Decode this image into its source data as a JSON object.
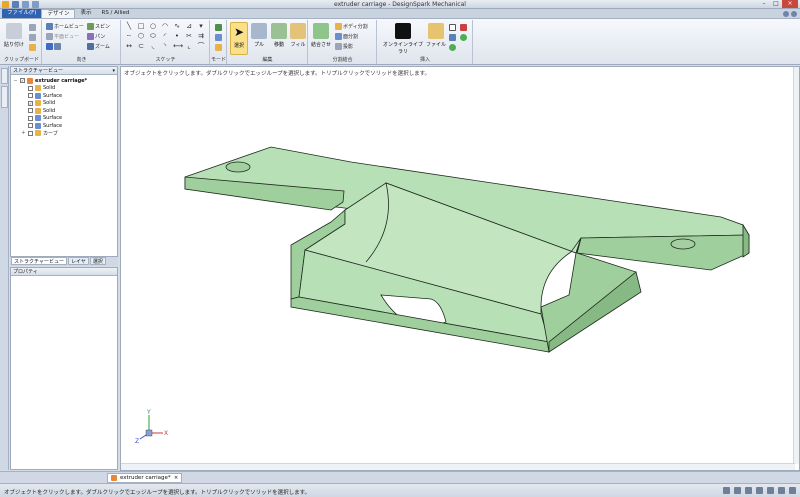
{
  "window": {
    "title": "extruder carriage - DesignSpark Mechanical"
  },
  "tabs": {
    "file": "ファイル(F)",
    "design": "デザイン",
    "display": "表示",
    "allied": "RS / Allied"
  },
  "ribbon": {
    "clipboard": {
      "paste": "貼り付け",
      "label": "クリップボード"
    },
    "orient": {
      "home": "ホームビュー",
      "plane": "平面ビュー",
      "rotate": "スピン",
      "pan": "パン",
      "zoom": "ズーム",
      "label": "向き"
    },
    "sketch": {
      "label": "スケッチ"
    },
    "mode": {
      "label": "モード"
    },
    "edit": {
      "select": "選択",
      "pull": "プル",
      "move": "移動",
      "fill": "フィル",
      "label": "編集"
    },
    "intersect": {
      "combine": "結合させ",
      "split_body": "ボディ分割",
      "split_face": "面分割",
      "project": "投影",
      "label": "分割結合"
    },
    "insert": {
      "online_library": "オンラインライブラリ",
      "file": "ファイル",
      "label": "挿入"
    }
  },
  "structure": {
    "header": "ストラクチャービュー",
    "root": "extruder carriage*",
    "items": [
      {
        "label": "Solid",
        "checked": false,
        "icon_color": "#e8b24a"
      },
      {
        "label": "Surface",
        "checked": false,
        "icon_color": "#6a8fcf"
      },
      {
        "label": "Solid",
        "checked": true,
        "icon_color": "#e8b24a"
      },
      {
        "label": "Solid",
        "checked": false,
        "icon_color": "#e8b24a"
      },
      {
        "label": "Surface",
        "checked": false,
        "icon_color": "#6a8fcf"
      },
      {
        "label": "Surface",
        "checked": false,
        "icon_color": "#6a8fcf"
      },
      {
        "label": "カーブ",
        "checked": false,
        "icon_color": "#e8b24a"
      }
    ]
  },
  "panel_tabs": [
    "ストラクチャービュー",
    "レイヤ",
    "選択"
  ],
  "properties": {
    "header": "プロパティ"
  },
  "viewport": {
    "hint": "オブジェクトをクリックします。ダブルクリックでエッジループを選択します。トリプルクリックでソリッドを選択します。",
    "axes": {
      "x": "X",
      "y": "Y",
      "z": "Z"
    }
  },
  "document_tab": {
    "name": "extruder carriage*",
    "close": "×"
  },
  "status": {
    "text": "オブジェクトをクリックします。ダブルクリックでエッジループを選択します。トリプルクリックでソリッドを選択します。"
  },
  "colors": {
    "part_top": "#b8e0b6",
    "part_side": "#9fcf9c",
    "part_dark": "#86b984",
    "part_edge": "#1d2b1d",
    "accent": "#2f62b3"
  }
}
